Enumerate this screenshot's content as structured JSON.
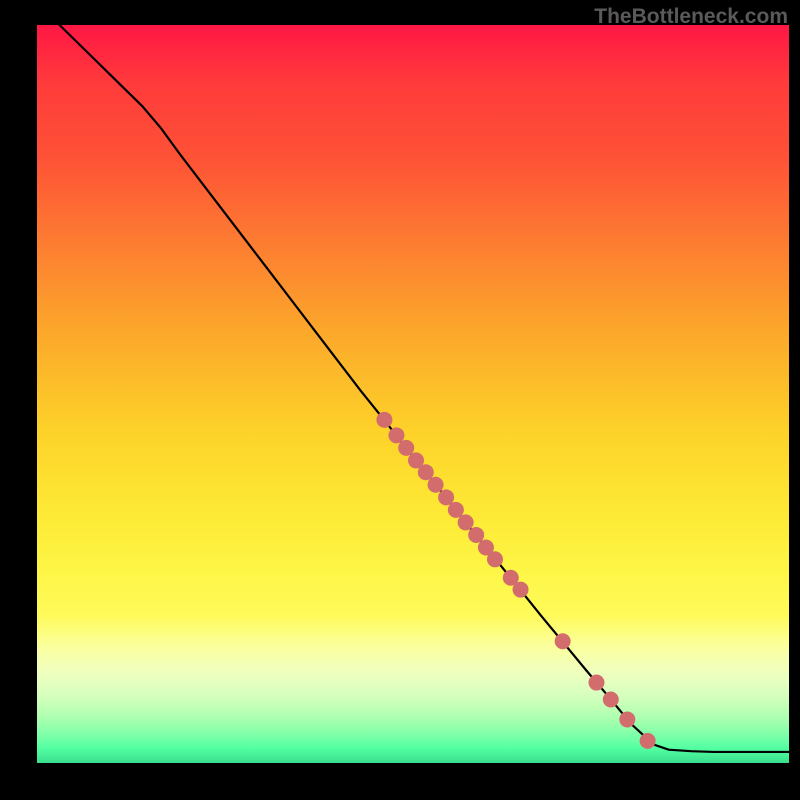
{
  "watermark": "TheBottleneck.com",
  "chart_data": {
    "type": "line",
    "title": "",
    "xlabel": "",
    "ylabel": "",
    "xlim": [
      0,
      100
    ],
    "ylim": [
      0,
      100
    ],
    "grid": false,
    "legend": false,
    "line": {
      "name": "curve",
      "color": "#000000",
      "points": [
        {
          "x": 2,
          "y": 101
        },
        {
          "x": 5,
          "y": 98
        },
        {
          "x": 8,
          "y": 95
        },
        {
          "x": 11,
          "y": 92
        },
        {
          "x": 14,
          "y": 89
        },
        {
          "x": 16.5,
          "y": 86
        },
        {
          "x": 19,
          "y": 82.5
        },
        {
          "x": 22,
          "y": 78.5
        },
        {
          "x": 25,
          "y": 74.5
        },
        {
          "x": 28,
          "y": 70.5
        },
        {
          "x": 31,
          "y": 66.5
        },
        {
          "x": 34,
          "y": 62.5
        },
        {
          "x": 37,
          "y": 58.5
        },
        {
          "x": 40,
          "y": 54.5
        },
        {
          "x": 43,
          "y": 50.5
        },
        {
          "x": 46,
          "y": 46.7
        },
        {
          "x": 49,
          "y": 42.8
        },
        {
          "x": 52,
          "y": 39
        },
        {
          "x": 55,
          "y": 35.2
        },
        {
          "x": 58,
          "y": 31.3
        },
        {
          "x": 61,
          "y": 27.6
        },
        {
          "x": 64,
          "y": 23.8
        },
        {
          "x": 67,
          "y": 20
        },
        {
          "x": 70,
          "y": 16.3
        },
        {
          "x": 73,
          "y": 12.6
        },
        {
          "x": 76,
          "y": 9
        },
        {
          "x": 79,
          "y": 5.3
        },
        {
          "x": 82,
          "y": 2.5
        },
        {
          "x": 84,
          "y": 1.8
        },
        {
          "x": 87,
          "y": 1.6
        },
        {
          "x": 90,
          "y": 1.5
        },
        {
          "x": 93,
          "y": 1.5
        },
        {
          "x": 96,
          "y": 1.5
        },
        {
          "x": 100,
          "y": 1.5
        }
      ]
    },
    "scatter": {
      "name": "markers",
      "color": "#d36d6d",
      "radius": 8,
      "points": [
        {
          "x": 46.2,
          "y": 46.5
        },
        {
          "x": 47.8,
          "y": 44.4
        },
        {
          "x": 49.1,
          "y": 42.7
        },
        {
          "x": 50.4,
          "y": 41.0
        },
        {
          "x": 51.7,
          "y": 39.4
        },
        {
          "x": 53.0,
          "y": 37.7
        },
        {
          "x": 54.4,
          "y": 36.0
        },
        {
          "x": 55.7,
          "y": 34.3
        },
        {
          "x": 57.0,
          "y": 32.6
        },
        {
          "x": 58.4,
          "y": 30.9
        },
        {
          "x": 59.7,
          "y": 29.2
        },
        {
          "x": 60.9,
          "y": 27.6
        },
        {
          "x": 63.0,
          "y": 25.1
        },
        {
          "x": 64.3,
          "y": 23.5
        },
        {
          "x": 69.9,
          "y": 16.5
        },
        {
          "x": 74.4,
          "y": 10.9
        },
        {
          "x": 76.3,
          "y": 8.6
        },
        {
          "x": 78.5,
          "y": 5.9
        },
        {
          "x": 81.2,
          "y": 3.0
        }
      ]
    }
  }
}
